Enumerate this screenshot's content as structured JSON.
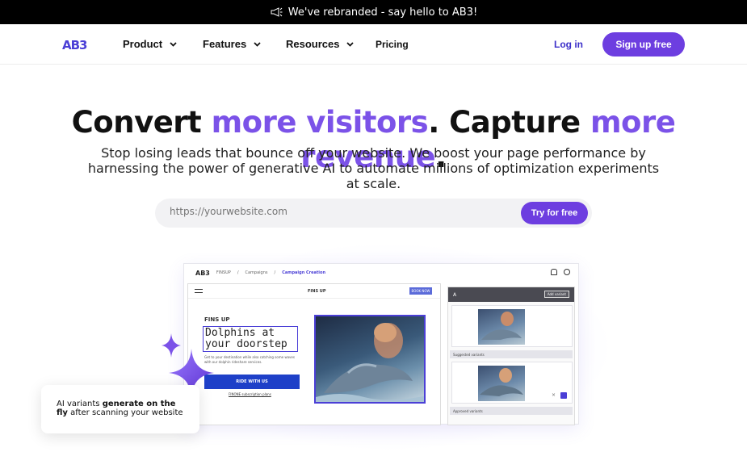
{
  "banner": {
    "text": "We've rebranded - say hello to AB3!",
    "icon": "megaphone-icon"
  },
  "nav": {
    "logo": "AB3",
    "items": [
      {
        "label": "Product",
        "has_dropdown": true
      },
      {
        "label": "Features",
        "has_dropdown": true
      },
      {
        "label": "Resources",
        "has_dropdown": true
      },
      {
        "label": "Pricing",
        "has_dropdown": false
      }
    ],
    "login": "Log in",
    "signup": "Sign up free"
  },
  "hero": {
    "title_part1": "Convert ",
    "title_accent1": "more visitors",
    "title_part2": ". Capture ",
    "title_accent2": "more revenue",
    "title_part3": ".",
    "subtitle": "Stop losing leads that bounce off your website. We boost your page performance by harnessing the power of generative AI to automate millions of optimization experiments at scale."
  },
  "url_form": {
    "placeholder": "https://yourwebsite.com",
    "button": "Try for free"
  },
  "mockup": {
    "logo": "AB3",
    "breadcrumbs": [
      "FINSUP",
      "Campaigns",
      "Campaign Creation"
    ],
    "preview": {
      "brand": "FINS UP",
      "book_button": "BOOK NOW",
      "small_brand": "FINS UP",
      "heading": "Dolphins at your doorstep",
      "body": "Get to your destination while also catching some waves with our dolphin rideshare services.",
      "cta": "RIDE WITH US",
      "plans_link": "FINONE subscription plans"
    },
    "side_panel": {
      "header": "A",
      "add_button": "Add variant",
      "suggested_label": "Suggested variants",
      "approved_label": "Approved variants"
    }
  },
  "float_card": {
    "prefix": "AI variants ",
    "bold": "generate on the fly",
    "suffix": " after scanning your website"
  },
  "colors": {
    "accent": "#7b52e8",
    "button": "#6d3ee0",
    "logo": "#4b3fd6"
  }
}
